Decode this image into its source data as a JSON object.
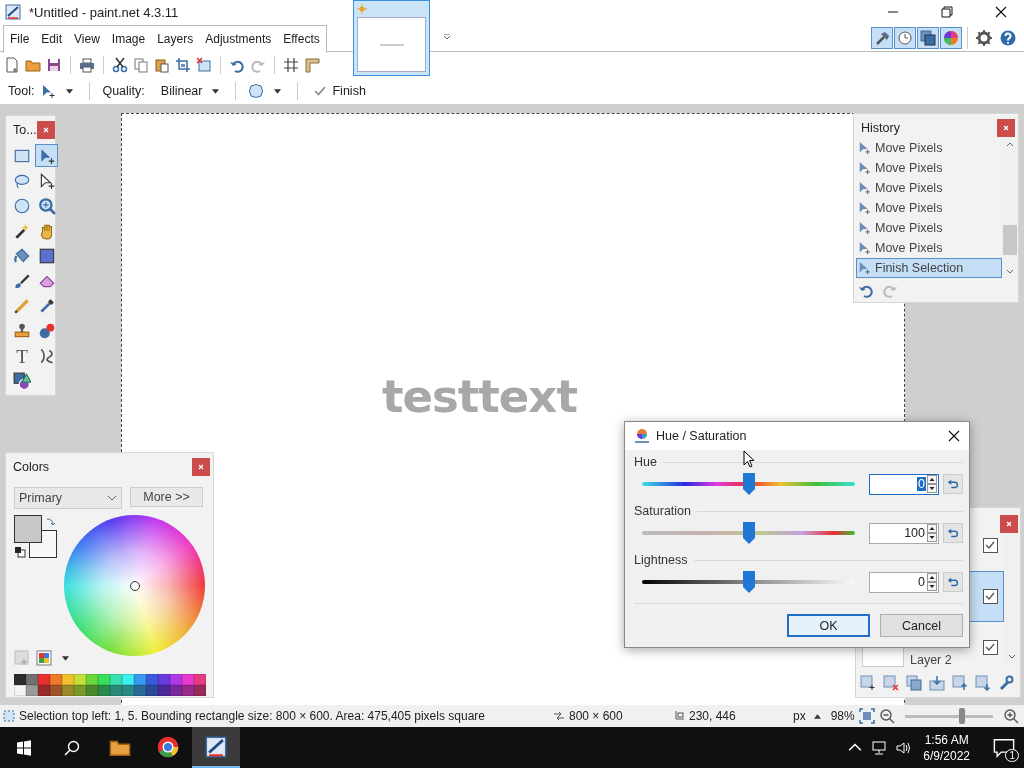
{
  "window": {
    "title": "*Untitled - paint.net 4.3.11"
  },
  "menu": [
    {
      "label": "File"
    },
    {
      "label": "Edit"
    },
    {
      "label": "View"
    },
    {
      "label": "Image"
    },
    {
      "label": "Layers"
    },
    {
      "label": "Adjustments"
    },
    {
      "label": "Effects"
    }
  ],
  "panel_toggles": [
    {
      "kind": "hammer",
      "on": true
    },
    {
      "kind": "clock",
      "on": true
    },
    {
      "kind": "layers",
      "on": true
    },
    {
      "kind": "color-wheel",
      "on": true
    }
  ],
  "tool_options": {
    "tool_label": "Tool:",
    "quality_label": "Quality:",
    "quality": "Bilinear",
    "finish": "Finish"
  },
  "canvas": {
    "text": "testtext"
  },
  "tools_panel": {
    "title": "To...",
    "tools": [
      {
        "kind": "rectangle-select",
        "selected": false
      },
      {
        "kind": "arrow-plus",
        "selected": true
      },
      {
        "kind": "lasso",
        "selected": false
      },
      {
        "kind": "arrow-outline",
        "selected": false
      },
      {
        "kind": "ellipse-select",
        "selected": false
      },
      {
        "kind": "magnifier",
        "selected": false
      },
      {
        "kind": "wand",
        "selected": false
      },
      {
        "kind": "hand",
        "selected": false
      },
      {
        "kind": "bucket",
        "selected": false
      },
      {
        "kind": "gradient",
        "selected": false
      },
      {
        "kind": "brush",
        "selected": false
      },
      {
        "kind": "eraser",
        "selected": false
      },
      {
        "kind": "pencil",
        "selected": false
      },
      {
        "kind": "dropper",
        "selected": false
      },
      {
        "kind": "stamp",
        "selected": false
      },
      {
        "kind": "recolor",
        "selected": false
      },
      {
        "kind": "text",
        "glyph": "T",
        "selected": false
      },
      {
        "kind": "curve",
        "selected": false
      },
      {
        "kind": "shapes",
        "selected": false
      }
    ]
  },
  "colors_panel": {
    "title": "Colors",
    "mode": "Primary",
    "more": "More >>",
    "palette": [
      {
        "color": "#2b2b2b"
      },
      {
        "color": "#6f6f6f"
      },
      {
        "color": "#e8302f"
      },
      {
        "color": "#f07a2a"
      },
      {
        "color": "#f2c12e"
      },
      {
        "color": "#c6e03a"
      },
      {
        "color": "#6ad83a"
      },
      {
        "color": "#38e05a"
      },
      {
        "color": "#3ae0b0"
      },
      {
        "color": "#3af0f0"
      },
      {
        "color": "#3a9af0"
      },
      {
        "color": "#3a5ae0"
      },
      {
        "color": "#6a3ae0"
      },
      {
        "color": "#b03ae8"
      },
      {
        "color": "#e83ad0"
      },
      {
        "color": "#e83a80"
      },
      {
        "color": "#f4f4f4"
      },
      {
        "color": "#9a9a9a"
      },
      {
        "color": "#9a2a2a"
      },
      {
        "color": "#a0522a"
      },
      {
        "color": "#9a8a2a"
      },
      {
        "color": "#7a9a2a"
      },
      {
        "color": "#4a8a2a"
      },
      {
        "color": "#2a8a4a"
      },
      {
        "color": "#2a8a7a"
      },
      {
        "color": "#2a8a8a"
      },
      {
        "color": "#2a6a9a"
      },
      {
        "color": "#2a4a9a"
      },
      {
        "color": "#4a2a9a"
      },
      {
        "color": "#7a2a9a"
      },
      {
        "color": "#9a2a8a"
      },
      {
        "color": "#9a2a5a"
      }
    ]
  },
  "history_panel": {
    "title": "History",
    "items": [
      {
        "label": "Move Pixels",
        "selected": false
      },
      {
        "label": "Move Pixels",
        "selected": false
      },
      {
        "label": "Move Pixels",
        "selected": false
      },
      {
        "label": "Move Pixels",
        "selected": false
      },
      {
        "label": "Move Pixels",
        "selected": false
      },
      {
        "label": "Move Pixels",
        "selected": false
      },
      {
        "label": "Finish Selection",
        "selected": true
      }
    ]
  },
  "layers_panel": {
    "layers": [
      {
        "visible": true,
        "selected": false
      },
      {
        "visible": true,
        "selected": true
      },
      {
        "name": "Layer 2",
        "visible": true,
        "selected": false
      }
    ]
  },
  "dialog": {
    "title": "Hue / Saturation",
    "sliders": [
      {
        "kind": "hue",
        "label": "Hue",
        "level": 0.5,
        "value": "0",
        "focused": true
      },
      {
        "kind": "saturation",
        "label": "Saturation",
        "level": 0.5,
        "value": "100",
        "focused": false
      },
      {
        "kind": "lightness",
        "label": "Lightness",
        "level": 0.5,
        "value": "0",
        "focused": false
      }
    ],
    "buttons": [
      {
        "label": "OK",
        "default": true
      },
      {
        "label": "Cancel",
        "default": false
      }
    ]
  },
  "status_bar": {
    "selection": "Selection top left: 1, 5. Bounding rectangle size: 800 × 600. Area: 475,405 pixels square",
    "image_size": "800 × 600",
    "cursor": "230, 446",
    "unit": "px",
    "zoom": "98%",
    "zoom_slider": {
      "level": 0.65
    }
  },
  "taskbar": {
    "apps": [
      {
        "kind": "folder",
        "active": false
      },
      {
        "kind": "round-app",
        "active": false
      },
      {
        "kind": "paint-app",
        "active": true
      }
    ],
    "time": "1:56 AM",
    "date": "6/9/2022",
    "notifications": "1"
  }
}
